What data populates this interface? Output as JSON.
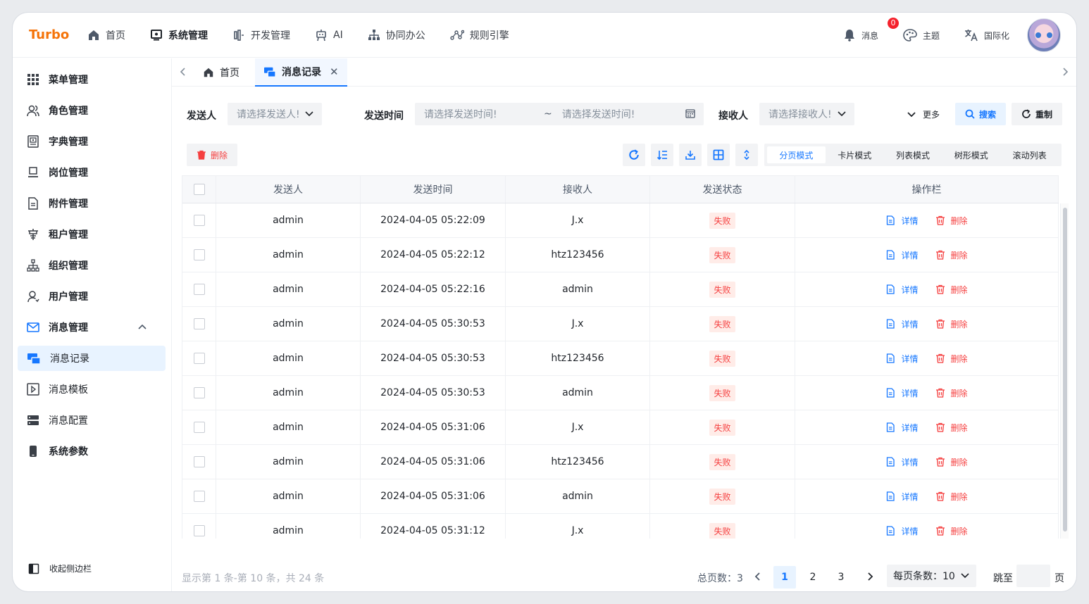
{
  "brand": "Turbo",
  "topnav": [
    {
      "label": "首页",
      "icon": "home-icon"
    },
    {
      "label": "系统管理",
      "icon": "monitor-icon",
      "active": true
    },
    {
      "label": "开发管理",
      "icon": "code-icon"
    },
    {
      "label": "AI",
      "icon": "robot-icon"
    },
    {
      "label": "协同办公",
      "icon": "org-icon"
    },
    {
      "label": "规则引擎",
      "icon": "rule-icon"
    }
  ],
  "topright": {
    "message": "消息",
    "message_badge": "0",
    "theme": "主题",
    "i18n": "国际化"
  },
  "sidebar": {
    "items": [
      {
        "label": "菜单管理",
        "icon": "grid-icon"
      },
      {
        "label": "角色管理",
        "icon": "users-icon"
      },
      {
        "label": "字典管理",
        "icon": "book-icon"
      },
      {
        "label": "岗位管理",
        "icon": "desk-icon"
      },
      {
        "label": "附件管理",
        "icon": "file-icon"
      },
      {
        "label": "租户管理",
        "icon": "building-icon"
      },
      {
        "label": "组织管理",
        "icon": "tree-icon"
      },
      {
        "label": "用户管理",
        "icon": "user-icon"
      },
      {
        "label": "消息管理",
        "icon": "mail-icon"
      },
      {
        "label": "消息记录",
        "icon": "message-record-icon"
      },
      {
        "label": "消息模板",
        "icon": "template-icon"
      },
      {
        "label": "消息配置",
        "icon": "server-icon"
      },
      {
        "label": "系统参数",
        "icon": "phone-icon"
      }
    ],
    "collapse_label": "收起侧边栏"
  },
  "tabs": [
    {
      "label": "首页"
    },
    {
      "label": "消息记录"
    }
  ],
  "filters": {
    "sender_label": "发送人",
    "sender_placeholder": "请选择发送人!",
    "time_label": "发送时间",
    "time_start_placeholder": "请选择发送时间!",
    "time_sep": "~",
    "time_end_placeholder": "请选择发送时间!",
    "receiver_label": "接收人",
    "receiver_placeholder": "请选择接收人!",
    "more": "更多",
    "search": "搜索",
    "reset": "重制"
  },
  "toolbar": {
    "delete": "删除",
    "modes": [
      "分页模式",
      "卡片模式",
      "列表模式",
      "树形模式",
      "滚动列表"
    ],
    "active_mode": "分页模式"
  },
  "table": {
    "columns": [
      "发送人",
      "发送时间",
      "接收人",
      "发送状态",
      "操作栏"
    ],
    "action_detail": "详情",
    "action_delete": "删除",
    "rows": [
      {
        "sender": "admin",
        "time": "2024-04-05 05:22:09",
        "receiver": "J.x",
        "status": "失败"
      },
      {
        "sender": "admin",
        "time": "2024-04-05 05:22:12",
        "receiver": "htz123456",
        "status": "失败"
      },
      {
        "sender": "admin",
        "time": "2024-04-05 05:22:16",
        "receiver": "admin",
        "status": "失败"
      },
      {
        "sender": "admin",
        "time": "2024-04-05 05:30:53",
        "receiver": "J.x",
        "status": "失败"
      },
      {
        "sender": "admin",
        "time": "2024-04-05 05:30:53",
        "receiver": "htz123456",
        "status": "失败"
      },
      {
        "sender": "admin",
        "time": "2024-04-05 05:30:53",
        "receiver": "admin",
        "status": "失败"
      },
      {
        "sender": "admin",
        "time": "2024-04-05 05:31:06",
        "receiver": "J.x",
        "status": "失败"
      },
      {
        "sender": "admin",
        "time": "2024-04-05 05:31:06",
        "receiver": "htz123456",
        "status": "失败"
      },
      {
        "sender": "admin",
        "time": "2024-04-05 05:31:06",
        "receiver": "admin",
        "status": "失败"
      },
      {
        "sender": "admin",
        "time": "2024-04-05 05:31:12",
        "receiver": "J.x",
        "status": "失败"
      }
    ]
  },
  "pager": {
    "info": "显示第 1 条-第 10 条，共 24 条",
    "total_pages": "总页数：3",
    "pages": [
      "1",
      "2",
      "3"
    ],
    "current": "1",
    "page_size": "每页条数：10",
    "jump_label": "跳至",
    "page_suffix": "页"
  },
  "colors": {
    "brand": "#f5740a",
    "primary": "#1677ff",
    "danger": "#f53f3f"
  }
}
